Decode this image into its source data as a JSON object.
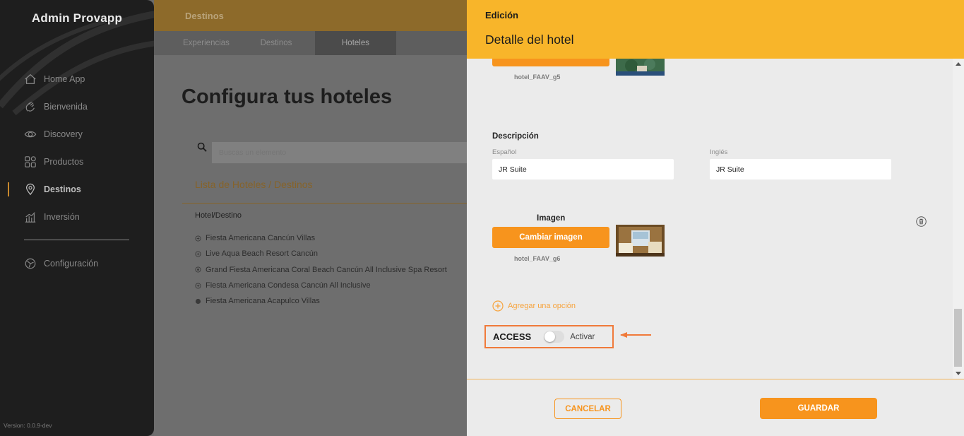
{
  "sidebar": {
    "brand": "Admin Provapp",
    "items": [
      {
        "label": "Home App",
        "icon": "home-icon"
      },
      {
        "label": "Bienvenida",
        "icon": "wave-hand-icon"
      },
      {
        "label": "Discovery",
        "icon": "eye-icon"
      },
      {
        "label": "Productos",
        "icon": "grid-icon"
      },
      {
        "label": "Destinos",
        "icon": "location-pin-icon",
        "active": true
      },
      {
        "label": "Inversión",
        "icon": "bar-chart-icon"
      }
    ],
    "config": {
      "label": "Configuración",
      "icon": "settings-icon"
    },
    "version": "Version: 0.0.9-dev"
  },
  "main": {
    "topbar_title": "Destinos",
    "tabs": [
      "Experiencias",
      "Destinos",
      "Hoteles"
    ],
    "active_tab": "Hoteles",
    "page_title": "Configura tus hoteles",
    "search_placeholder": "Buscas un elemento",
    "list_title": "Lista de Hoteles / Destinos",
    "column_header": "Hotel/Destino",
    "hotels": [
      "Fiesta Americana Cancún Villas",
      "Live Aqua Beach Resort Cancún",
      "Grand Fiesta Americana Coral Beach Cancún All Inclusive Spa Resort",
      "Fiesta Americana Condesa Cancún All Inclusive",
      "Fiesta Americana Acapulco Villas"
    ]
  },
  "drawer": {
    "section": "Edición",
    "title": "Detalle del hotel",
    "image_top": {
      "filename": "hotel_FAAV_g5"
    },
    "description": {
      "title": "Descripción",
      "es_label": "Español",
      "es_value": "JR Suite",
      "en_label": "Inglés",
      "en_value": "JR Suite"
    },
    "image": {
      "label": "Imagen",
      "button": "Cambiar imagen",
      "filename": "hotel_FAAV_g6"
    },
    "add_option": "Agregar una opción",
    "access": {
      "label": "ACCESS",
      "toggle_label": "Activar",
      "enabled": false
    },
    "cancel": "CANCELAR",
    "save": "GUARDAR"
  },
  "colors": {
    "accent": "#f7941d",
    "header": "#f8b52a",
    "highlight": "#f07a3a",
    "sidebar": "#1e1e1e"
  }
}
